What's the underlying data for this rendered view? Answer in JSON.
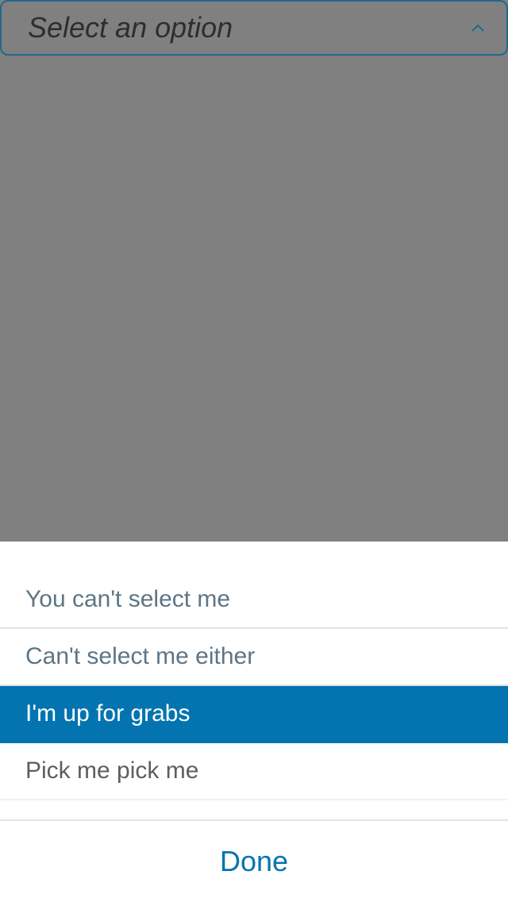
{
  "select": {
    "placeholder": "Select an option",
    "icon": "chevron-up-icon",
    "border_color": "#1f6a8c"
  },
  "options": [
    {
      "label": "You can't select me",
      "state": "disabled"
    },
    {
      "label": "Can't select me either",
      "state": "disabled"
    },
    {
      "label": "I'm up for grabs",
      "state": "selected"
    },
    {
      "label": "Pick me pick me",
      "state": "enabled"
    }
  ],
  "footer": {
    "done_label": "Done"
  },
  "colors": {
    "accent": "#0374b0",
    "overlay": "#808080",
    "disabled_text": "#5d7585",
    "enabled_text": "#5e5e5e"
  }
}
